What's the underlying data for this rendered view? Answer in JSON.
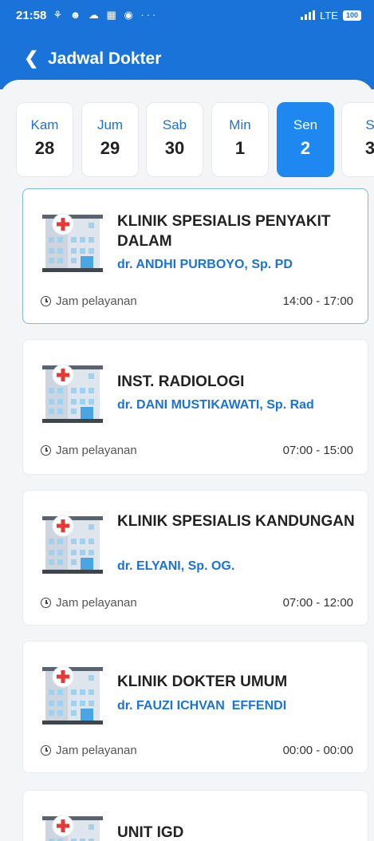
{
  "status_bar": {
    "time": "21:58",
    "indicators": "⚘ ☻ ☁ ▦ ◉ ···",
    "network": "LTE",
    "battery": "100"
  },
  "header": {
    "back_icon": "chevron-left-icon",
    "title": "Jadwal Dokter"
  },
  "dates": [
    {
      "day": "Kam",
      "num": "28"
    },
    {
      "day": "Jum",
      "num": "29"
    },
    {
      "day": "Sab",
      "num": "30"
    },
    {
      "day": "Min",
      "num": "1"
    },
    {
      "day": "Sen",
      "num": "2"
    },
    {
      "day": "S",
      "num": "3"
    }
  ],
  "service_label": "Jam pelayanan",
  "cards": [
    {
      "name": "KLINIK SPESIALIS PENYAKIT DALAM",
      "doctor": "dr. ANDHI PURBOYO, Sp. PD",
      "hours": "14:00 - 17:00"
    },
    {
      "name": "INST. RADIOLOGI",
      "doctor": "dr. DANI MUSTIKAWATI, Sp. Rad",
      "hours": "07:00 - 15:00"
    },
    {
      "name": "KLINIK SPESIALIS KANDUNGAN",
      "doctor": "dr. ELYANI, Sp. OG.",
      "hours": "07:00 - 12:00"
    },
    {
      "name": "KLINIK DOKTER UMUM",
      "doctor": "dr. FAUZI ICHVAN  EFFENDI",
      "hours": "00:00 - 00:00"
    },
    {
      "name": "UNIT IGD",
      "doctor": "",
      "hours": ""
    }
  ],
  "colors": {
    "primary": "#1a73d9",
    "active_date": "#1e88f0",
    "background": "#f4f5f7"
  }
}
